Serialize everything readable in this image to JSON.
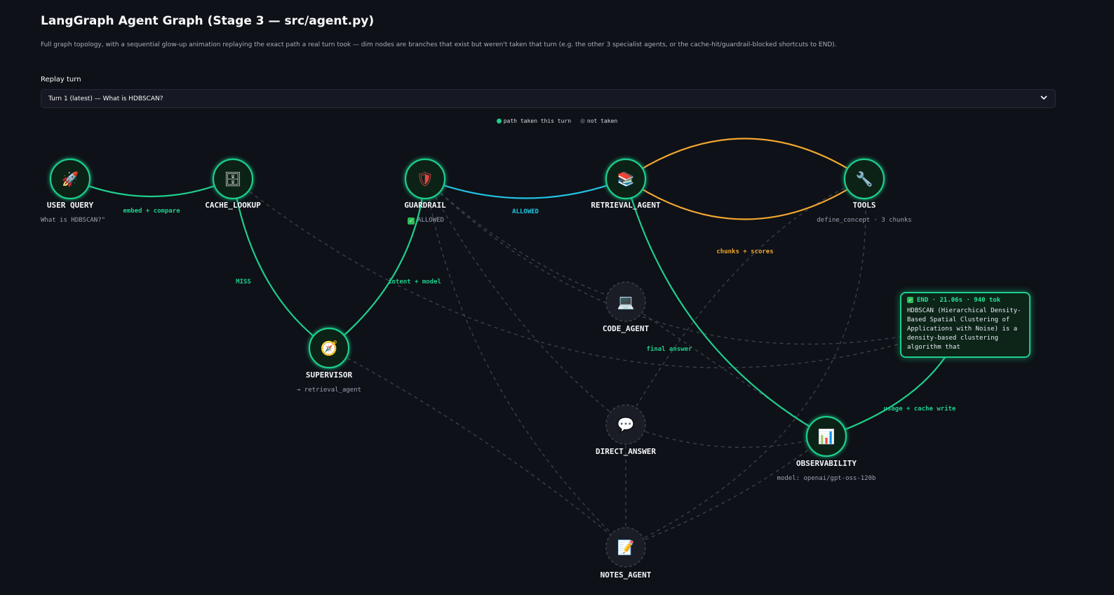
{
  "header": {
    "title": "LangGraph Agent Graph (Stage 3 — src/agent.py)",
    "subtitle": "Full graph topology, with a sequential glow-up animation replaying the exact path a real turn took — dim nodes are branches that exist but weren't taken that turn (e.g. the other 3 specialist agents, or the cache-hit/guardrail-blocked shortcuts to END)."
  },
  "replay": {
    "label": "Replay turn",
    "selected": "Turn 1 (latest) — What is HDBSCAN?"
  },
  "legend": {
    "taken": "path taken this turn",
    "not_taken": "not taken",
    "taken_color": "#1fce8d",
    "not_taken_color": "#3a3f4b"
  },
  "colors": {
    "active": "#1fce8d",
    "allowed": "#22c3e6",
    "tools": "#f2a731",
    "inactive": "#3a3f4b"
  },
  "nodes": {
    "user_query": {
      "label": "USER QUERY",
      "sub": "What is HDBSCAN?\"",
      "icon": "rocket-icon",
      "glyph": "🚀"
    },
    "cache_lookup": {
      "label": "CACHE_LOOKUP",
      "icon": "cabinet-icon",
      "glyph": "🗄"
    },
    "guardrail": {
      "label": "GUARDRAIL",
      "sub": "ALLOWED",
      "icon": "shield-icon",
      "glyph": "🛡"
    },
    "retrieval_agent": {
      "label": "RETRIEVAL_AGENT",
      "icon": "books-icon",
      "glyph": "📚"
    },
    "tools": {
      "label": "TOOLS",
      "sub": "define_concept · 3 chunks",
      "icon": "wrench-icon",
      "glyph": "🔧"
    },
    "supervisor": {
      "label": "SUPERVISOR",
      "sub": "→ retrieval_agent",
      "icon": "compass-icon",
      "glyph": "🧭"
    },
    "code_agent": {
      "label": "CODE_AGENT",
      "icon": "laptop-icon",
      "glyph": "💻"
    },
    "direct_answer": {
      "label": "DIRECT_ANSWER",
      "icon": "speech-bubble-icon",
      "glyph": "💬"
    },
    "observability": {
      "label": "OBSERVABILITY",
      "sub": "model: openai/gpt-oss-120b",
      "icon": "bar-chart-icon",
      "glyph": "📊"
    },
    "notes_agent": {
      "label": "NOTES_AGENT",
      "icon": "memo-icon",
      "glyph": "📝"
    }
  },
  "edges": {
    "embed_compare": "embed + compare",
    "miss": "MISS",
    "intent_model": "intent + model",
    "allowed": "ALLOWED",
    "chunks_scores": "chunks + scores",
    "final_answer": "final answer",
    "usage_cache": "usage + cache write"
  },
  "end": {
    "header": "END · 21.06s · 940 tok",
    "text": "HDBSCAN (Hierarchical Density-Based Spatial Clustering of Applications with Noise) is a density-based clustering algorithm that"
  }
}
